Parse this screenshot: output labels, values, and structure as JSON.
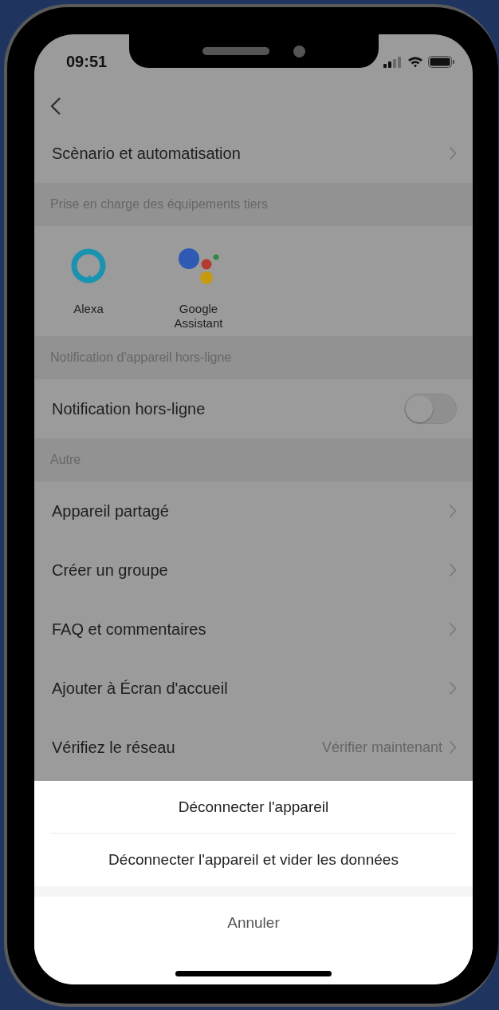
{
  "status_bar": {
    "time": "09:51"
  },
  "settings": [
    {
      "kind": "link",
      "label": "Scènario et automatisation"
    },
    {
      "kind": "header",
      "label": "Prise en charge des équipements tiers"
    },
    {
      "kind": "integrations",
      "items": [
        {
          "label": "Alexa"
        },
        {
          "label": "Google Assistant"
        }
      ]
    },
    {
      "kind": "header",
      "label": "Notification d'appareil hors-ligne"
    },
    {
      "kind": "toggle",
      "label": "Notification hors-ligne",
      "on": false
    },
    {
      "kind": "header",
      "label": "Autre"
    },
    {
      "kind": "link",
      "label": "Appareil partagé"
    },
    {
      "kind": "link",
      "label": "Créer un groupe"
    },
    {
      "kind": "link",
      "label": "FAQ et commentaires"
    },
    {
      "kind": "link",
      "label": "Ajouter à Écran d'accueil"
    },
    {
      "kind": "link",
      "label": "Vérifiez le réseau",
      "value": "Vérifier maintenant"
    }
  ],
  "action_sheet": {
    "options": [
      "Déconnecter l'appareil",
      "Déconnecter l'appareil et vider les données"
    ],
    "cancel": "Annuler"
  }
}
